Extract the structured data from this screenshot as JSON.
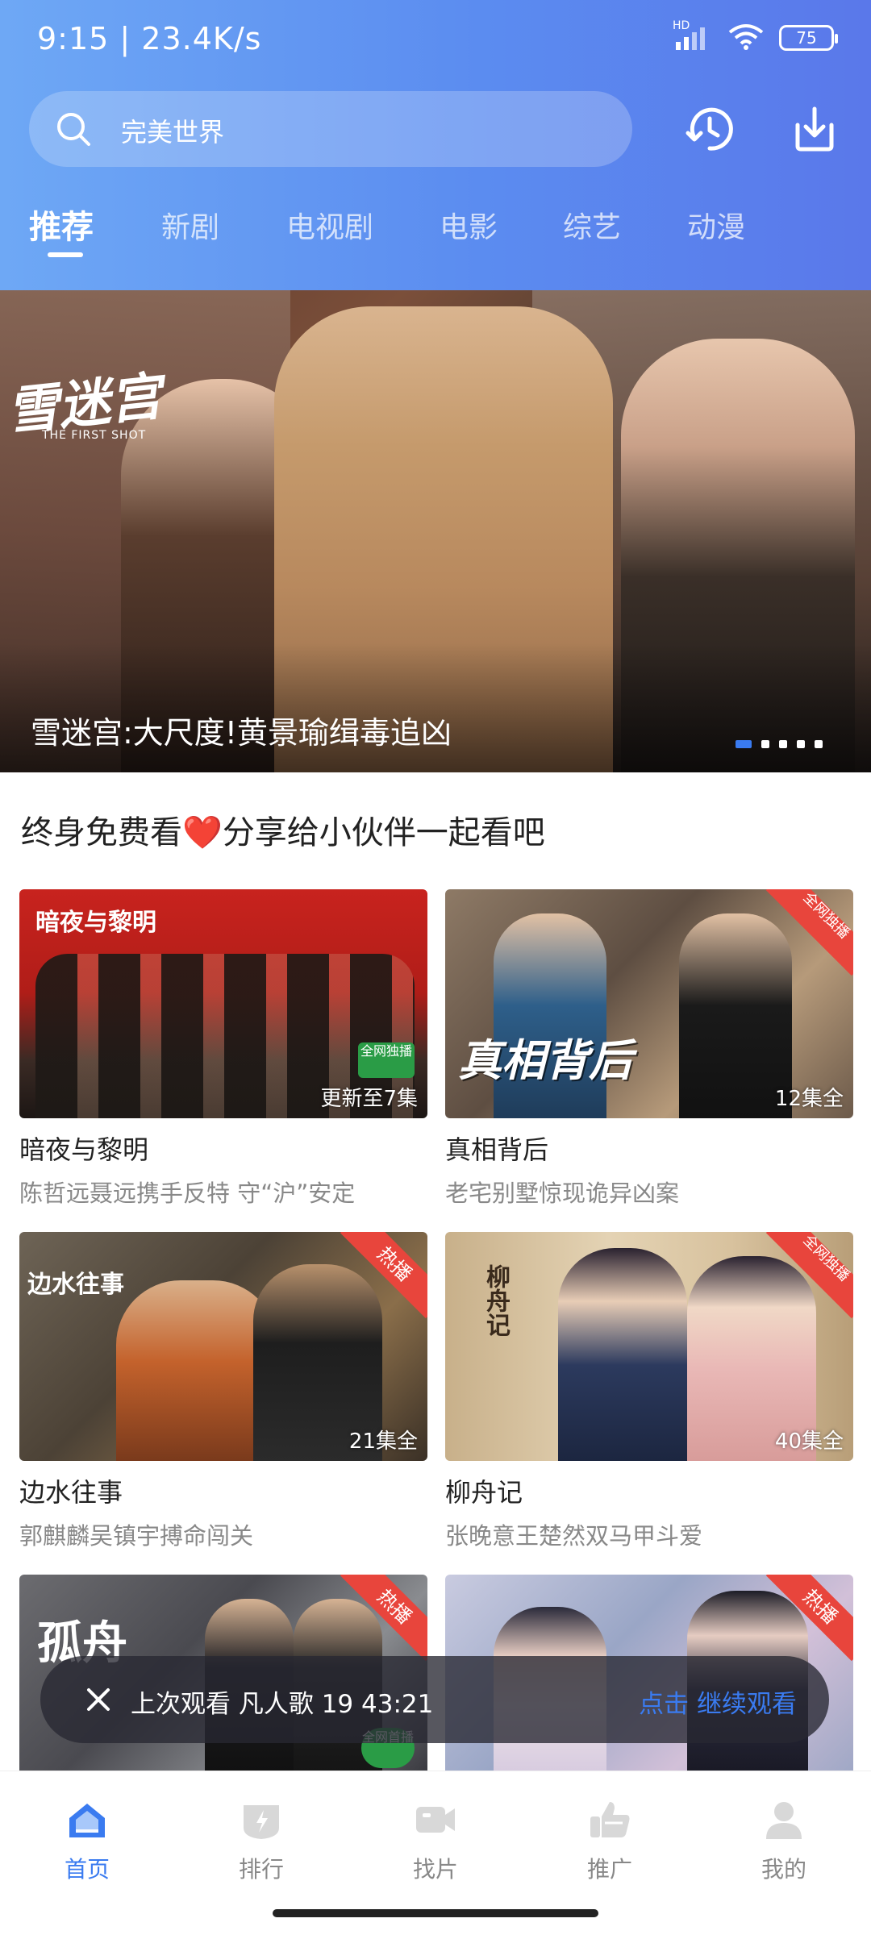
{
  "status_bar": {
    "time_speed": "9:15 | 23.4K/s",
    "signal_label": "HD",
    "battery": "75"
  },
  "search": {
    "placeholder": "完美世界"
  },
  "tabs": [
    {
      "label": "推荐",
      "active": true
    },
    {
      "label": "新剧",
      "active": false
    },
    {
      "label": "电视剧",
      "active": false
    },
    {
      "label": "电影",
      "active": false
    },
    {
      "label": "综艺",
      "active": false
    },
    {
      "label": "动漫",
      "active": false
    }
  ],
  "banner": {
    "title": "雪迷宫:大尺度!黄景瑜缉毒追凶",
    "logo_text": "雪迷宫",
    "logo_sub": "THE FIRST SHOT",
    "dots": 5,
    "active_dot": 0
  },
  "section": {
    "title_before": "终身免费看",
    "title_heart": "❤️",
    "title_after": "分享给小伙伴一起看吧"
  },
  "cards": [
    {
      "title": "暗夜与黎明",
      "desc": "陈哲远聂远携手反特 守“沪”安定",
      "count": "更新至7集",
      "ribbon": "",
      "poster_title": "暗夜与黎明",
      "badge": "全网独播"
    },
    {
      "title": "真相背后",
      "desc": "老宅别墅惊现诡异凶案",
      "count": "12集全",
      "ribbon": "全网独播",
      "poster_title": "真相背后",
      "badge": ""
    },
    {
      "title": "边水往事",
      "desc": "郭麒麟吴镇宇搏命闯关",
      "count": "21集全",
      "ribbon": "热播",
      "poster_title": "边水往事",
      "badge": ""
    },
    {
      "title": "柳舟记",
      "desc": "张晚意王楚然双马甲斗爱",
      "count": "40集全",
      "ribbon": "全网独播",
      "poster_title": "柳舟记",
      "badge": ""
    },
    {
      "title": "孤舟",
      "desc": "",
      "count": "",
      "ribbon": "热播",
      "poster_title": "孤舟",
      "badge": "全网首播"
    },
    {
      "title": "",
      "desc": "",
      "count": "",
      "ribbon": "热播",
      "poster_title": "",
      "badge": ""
    }
  ],
  "continue_watching": {
    "text": "上次观看  凡人歌 19   43:21",
    "link": "点击 继续观看"
  },
  "bottom_nav": [
    {
      "label": "首页",
      "icon": "home-icon",
      "active": true
    },
    {
      "label": "排行",
      "icon": "ranking-icon",
      "active": false
    },
    {
      "label": "找片",
      "icon": "video-camera-icon",
      "active": false
    },
    {
      "label": "推广",
      "icon": "thumbs-up-icon",
      "active": false
    },
    {
      "label": "我的",
      "icon": "user-icon",
      "active": false
    }
  ],
  "colors": {
    "accent": "#3a7bf0",
    "header_start": "#6ea8f5",
    "header_end": "#5a78ea",
    "ribbon": "#e8453c"
  }
}
